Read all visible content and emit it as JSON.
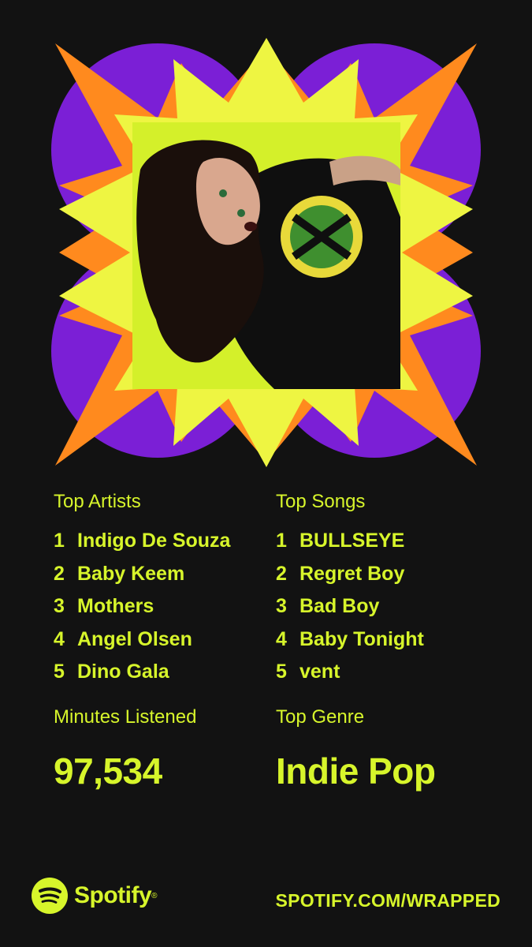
{
  "theme": {
    "background": "#121212",
    "accent": "#d7f52b",
    "purple": "#7b1fd6",
    "orange": "#ff8a1e",
    "yellow": "#eef542"
  },
  "top_artists": {
    "title": "Top Artists",
    "items": [
      {
        "rank": "1",
        "name": "Indigo De Souza"
      },
      {
        "rank": "2",
        "name": "Baby Keem"
      },
      {
        "rank": "3",
        "name": "Mothers"
      },
      {
        "rank": "4",
        "name": "Angel Olsen"
      },
      {
        "rank": "5",
        "name": "Dino Gala"
      }
    ]
  },
  "top_songs": {
    "title": "Top Songs",
    "items": [
      {
        "rank": "1",
        "name": "BULLSEYE"
      },
      {
        "rank": "2",
        "name": "Regret Boy"
      },
      {
        "rank": "3",
        "name": "Bad Boy"
      },
      {
        "rank": "4",
        "name": "Baby Tonight"
      },
      {
        "rank": "5",
        "name": "vent"
      }
    ]
  },
  "minutes": {
    "title": "Minutes Listened",
    "value": "97,534"
  },
  "genre": {
    "title": "Top Genre",
    "value": "Indie Pop"
  },
  "footer": {
    "brand": "Spotify",
    "brand_mark": "®",
    "url": "SPOTIFY.COM/WRAPPED",
    "logo_icon": "spotify-logo-icon"
  }
}
